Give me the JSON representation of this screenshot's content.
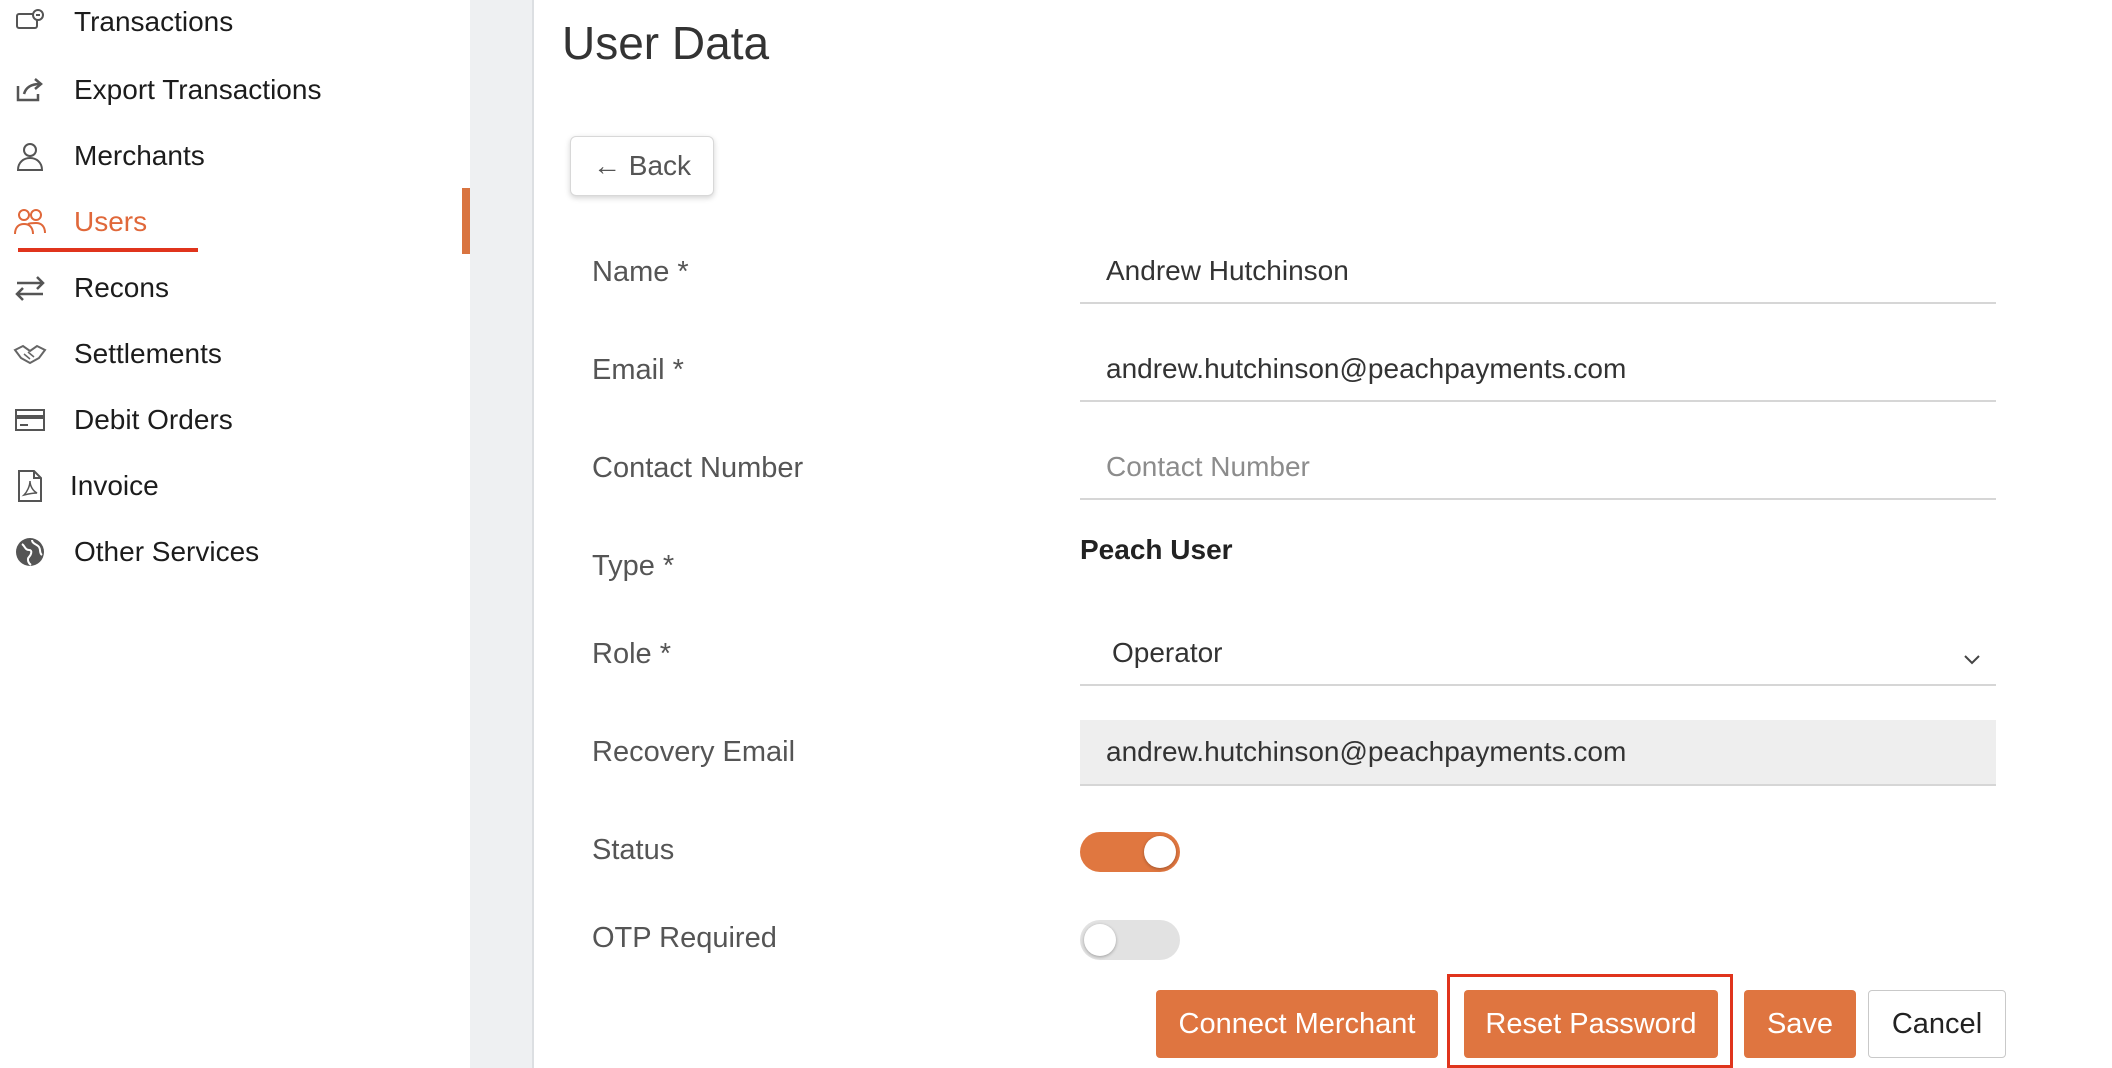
{
  "sidebar": {
    "items": [
      {
        "label": "Transactions",
        "icon": "transactions-icon"
      },
      {
        "label": "Export Transactions",
        "icon": "export-icon"
      },
      {
        "label": "Merchants",
        "icon": "merchant-icon"
      },
      {
        "label": "Users",
        "icon": "users-icon",
        "active": true
      },
      {
        "label": "Recons",
        "icon": "arrows-swap-icon"
      },
      {
        "label": "Settlements",
        "icon": "handshake-icon"
      },
      {
        "label": "Debit Orders",
        "icon": "card-icon"
      },
      {
        "label": "Invoice",
        "icon": "pdf-icon"
      },
      {
        "label": "Other Services",
        "icon": "globe-icon"
      }
    ]
  },
  "main": {
    "title": "User Data",
    "back_label": "← Back",
    "form": {
      "name_label": "Name *",
      "name_value": "Andrew Hutchinson",
      "email_label": "Email *",
      "email_value": "andrew.hutchinson@peachpayments.com",
      "contact_label": "Contact Number",
      "contact_placeholder": "Contact Number",
      "type_label": "Type *",
      "type_value": "Peach User",
      "role_label": "Role *",
      "role_value": "Operator",
      "recovery_label": "Recovery Email",
      "recovery_value": "andrew.hutchinson@peachpayments.com",
      "status_label": "Status",
      "status_on": true,
      "otp_label": "OTP Required",
      "otp_on": false
    },
    "actions": {
      "connect_merchant": "Connect Merchant",
      "reset_password": "Reset Password",
      "save": "Save",
      "cancel": "Cancel"
    }
  },
  "colors": {
    "accent": "#df7540",
    "highlight": "#e0341c"
  }
}
